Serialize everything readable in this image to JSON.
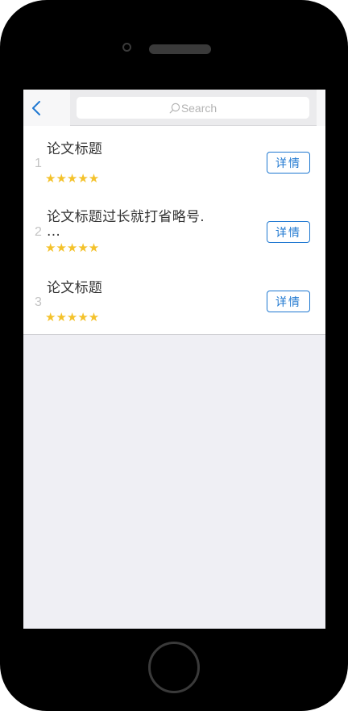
{
  "colors": {
    "accent": "#1f78d1",
    "star": "#f4c22b",
    "screen_bg": "#efeff4"
  },
  "nav": {
    "back_icon": "chevron-left-icon",
    "search": {
      "icon": "search-icon",
      "placeholder": "Search"
    }
  },
  "items": [
    {
      "index": "1",
      "title": "论文标题",
      "stars": "★★★★★",
      "rating": 5,
      "button": "详情"
    },
    {
      "index": "2",
      "title": "论文标题过长就打省略号.\n...",
      "stars": "★★★★★",
      "rating": 5,
      "button": "详情"
    },
    {
      "index": "3",
      "title": "论文标题",
      "stars": "★★★★★",
      "rating": 5,
      "button": "详情"
    }
  ]
}
